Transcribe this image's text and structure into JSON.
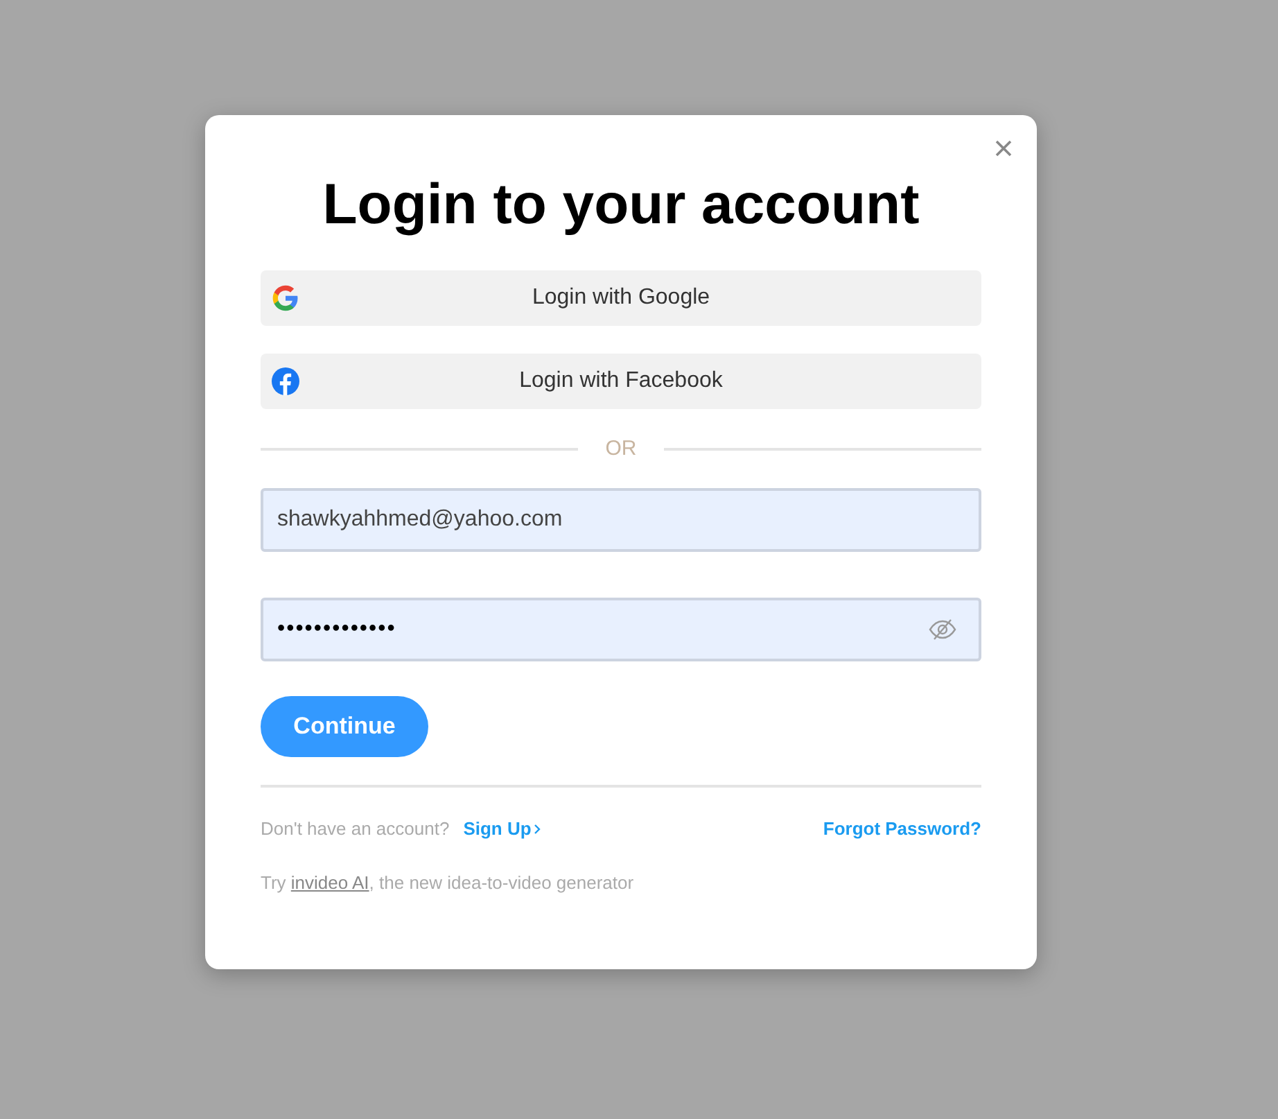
{
  "dialog": {
    "title": "Login to your account",
    "social_buttons": [
      {
        "kind": "google",
        "label": "Login with Google"
      },
      {
        "kind": "facebook",
        "label": "Login with Facebook"
      }
    ],
    "separator": "OR",
    "email": {
      "value": "shawkyahhmed@yahoo.com"
    },
    "password": {
      "value": "•••••••••••••"
    },
    "continue_button": "Continue",
    "signup_prompt": "Don't have an account?",
    "signup_link": "Sign Up",
    "forgot_link": "Forgot Password?",
    "promo": {
      "before": "Try ",
      "link": "invideo AI",
      "after": ", the new idea-to-video generator"
    }
  }
}
